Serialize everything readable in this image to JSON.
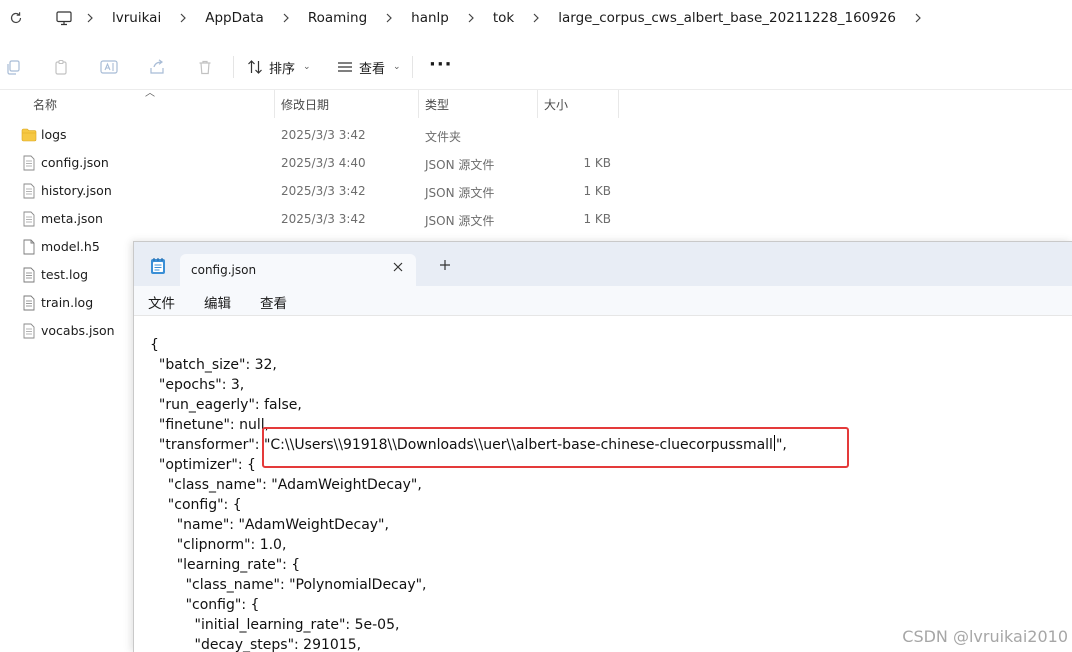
{
  "addressbar": {
    "breadcrumbs": [
      "lvruikai",
      "AppData",
      "Roaming",
      "hanlp",
      "tok",
      "large_corpus_cws_albert_base_20211228_160926"
    ]
  },
  "toolbar": {
    "sort_label": "排序",
    "view_label": "查看",
    "more_label": "···"
  },
  "columns": {
    "name": "名称",
    "modified": "修改日期",
    "type": "类型",
    "size": "大小"
  },
  "files": [
    {
      "name": "logs",
      "date": "2025/3/3 3:42",
      "type": "文件夹",
      "size": "",
      "icon": "folder-icon"
    },
    {
      "name": "config.json",
      "date": "2025/3/3 4:40",
      "type": "JSON 源文件",
      "size": "1 KB",
      "icon": "json-file-icon"
    },
    {
      "name": "history.json",
      "date": "2025/3/3 3:42",
      "type": "JSON 源文件",
      "size": "1 KB",
      "icon": "json-file-icon"
    },
    {
      "name": "meta.json",
      "date": "2025/3/3 3:42",
      "type": "JSON 源文件",
      "size": "1 KB",
      "icon": "json-file-icon"
    },
    {
      "name": "model.h5",
      "date": "",
      "type": "",
      "size": "",
      "icon": "file-icon"
    },
    {
      "name": "test.log",
      "date": "",
      "type": "",
      "size": "",
      "icon": "text-file-icon"
    },
    {
      "name": "train.log",
      "date": "",
      "type": "",
      "size": "",
      "icon": "text-file-icon"
    },
    {
      "name": "vocabs.json",
      "date": "",
      "type": "",
      "size": "",
      "icon": "json-file-icon"
    }
  ],
  "notepad": {
    "tab_title": "config.json",
    "menu": [
      "文件",
      "编辑",
      "查看"
    ],
    "lines": [
      "{",
      "  \"batch_size\": 32,",
      "  \"epochs\": 3,",
      "  \"run_eagerly\": false,",
      "  \"finetune\": null,",
      "  \"transformer\": ",
      "  \"optimizer\": {",
      "    \"class_name\": \"AdamWeightDecay\",",
      "    \"config\": {",
      "      \"name\": \"AdamWeightDecay\",",
      "      \"clipnorm\": 1.0,",
      "      \"learning_rate\": {",
      "        \"class_name\": \"PolynomialDecay\",",
      "        \"config\": {",
      "          \"initial_learning_rate\": 5e-05,",
      "          \"decay_steps\": 291015,"
    ],
    "transformer_value_before_caret": "\"C:\\\\Users\\\\91918\\\\Downloads\\\\uer\\\\albert-base-chinese-cluecorpussmall",
    "transformer_value_after_caret": "\","
  },
  "watermark": "CSDN @lvruikai2010",
  "colors": {
    "highlight": "#e43a3a",
    "notepad_tabbar": "#e8edf5",
    "folder": "#f6c844"
  }
}
